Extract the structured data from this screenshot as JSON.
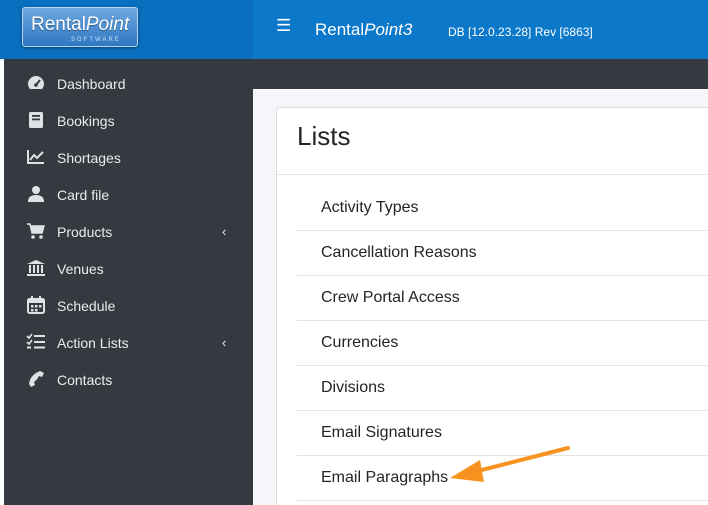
{
  "header": {
    "logo_text_1": "Rental",
    "logo_text_2": "Point",
    "logo_subtext": "SOFTWARE",
    "menu_toggle": "☰",
    "app_title_1": "Rental",
    "app_title_2": "Point3",
    "version": "DB [12.0.23.28]   Rev [6863]"
  },
  "sidebar": {
    "items": [
      {
        "label": "Dashboard",
        "icon": "dashboard-icon"
      },
      {
        "label": "Bookings",
        "icon": "book-icon"
      },
      {
        "label": "Shortages",
        "icon": "chart-line-icon"
      },
      {
        "label": "Card file",
        "icon": "user-icon"
      },
      {
        "label": "Products",
        "icon": "cart-icon",
        "arrow": "‹"
      },
      {
        "label": "Venues",
        "icon": "bank-icon"
      },
      {
        "label": "Schedule",
        "icon": "calendar-icon"
      },
      {
        "label": "Action Lists",
        "icon": "tasks-icon",
        "arrow": "‹"
      },
      {
        "label": "Contacts",
        "icon": "phone-icon"
      }
    ]
  },
  "main": {
    "title": "Lists",
    "items": [
      "Activity Types",
      "Cancellation Reasons",
      "Crew Portal Access",
      "Currencies",
      "Divisions",
      "Email Signatures",
      "Email Paragraphs"
    ]
  },
  "colors": {
    "header": "#0c78c9",
    "sidebar": "#343a40",
    "annotation_arrow": "#f7931e"
  }
}
